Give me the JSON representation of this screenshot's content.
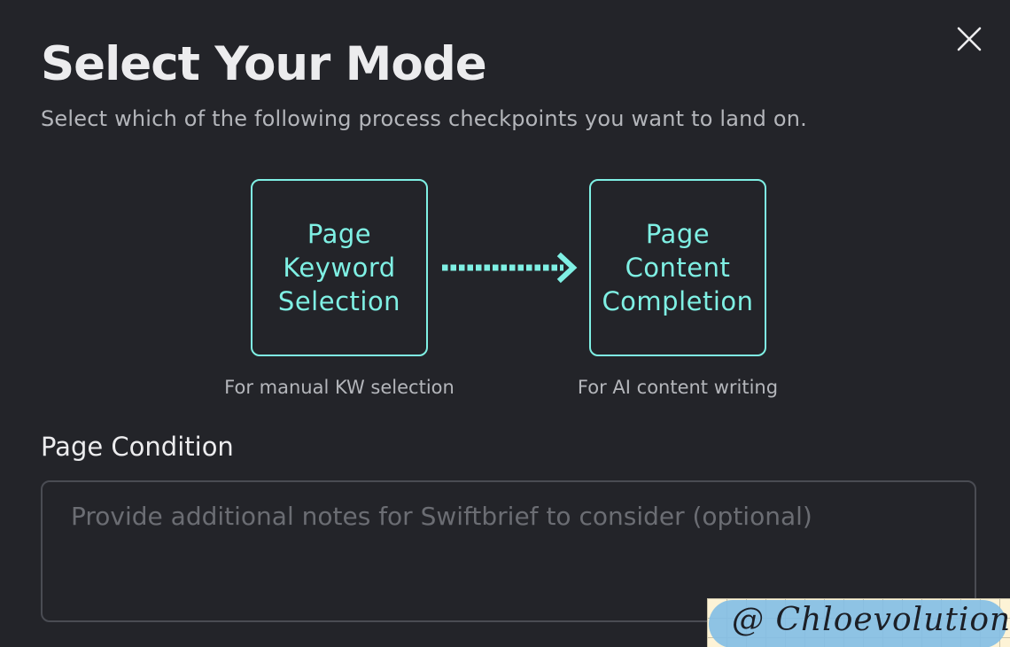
{
  "dialog": {
    "title": "Select Your Mode",
    "subtitle": "Select which of the following process checkpoints you want to land on.",
    "close_icon": "close-icon"
  },
  "modes": [
    {
      "lines": [
        "Page",
        "Keyword",
        "Selection"
      ],
      "caption": "For manual KW selection"
    },
    {
      "lines": [
        "Page",
        "Content",
        "Completion"
      ],
      "caption": "For AI content writing"
    }
  ],
  "flow_arrow_icon": "dotted-arrow-right-icon",
  "page_condition": {
    "label": "Page Condition",
    "placeholder": "Provide additional notes for Swiftbrief to consider (optional)",
    "value": ""
  },
  "watermark": {
    "text": "@ Chloevolution"
  },
  "colors": {
    "background": "#232429",
    "accent": "#7ff0e4",
    "text_primary": "#ececee",
    "text_secondary": "#b4b6bb",
    "placeholder": "#6b6d73",
    "input_border": "#4a4c53"
  }
}
